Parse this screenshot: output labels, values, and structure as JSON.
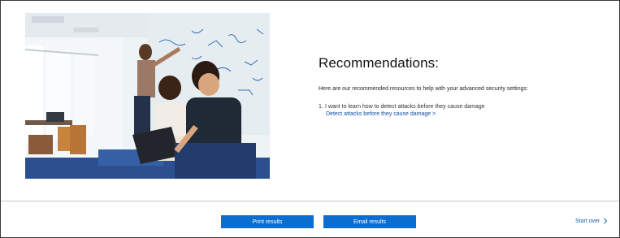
{
  "recommendations": {
    "title": "Recommendations:",
    "intro": "Here are our recommended resources to help with your advanced security settings:",
    "items": [
      {
        "number": "1.",
        "text": "I want to learn how to detect attacks before they cause damage",
        "link_label": "Detect attacks before they cause damage >"
      }
    ]
  },
  "footer": {
    "print_label": "Print results",
    "email_label": "Email results",
    "start_over_label": "Start over",
    "start_over_icon": "chevron-right-icon"
  },
  "colors": {
    "primary_button": "#0a6ed1",
    "link": "#0f4fa8",
    "divider": "#c8c8c8"
  }
}
